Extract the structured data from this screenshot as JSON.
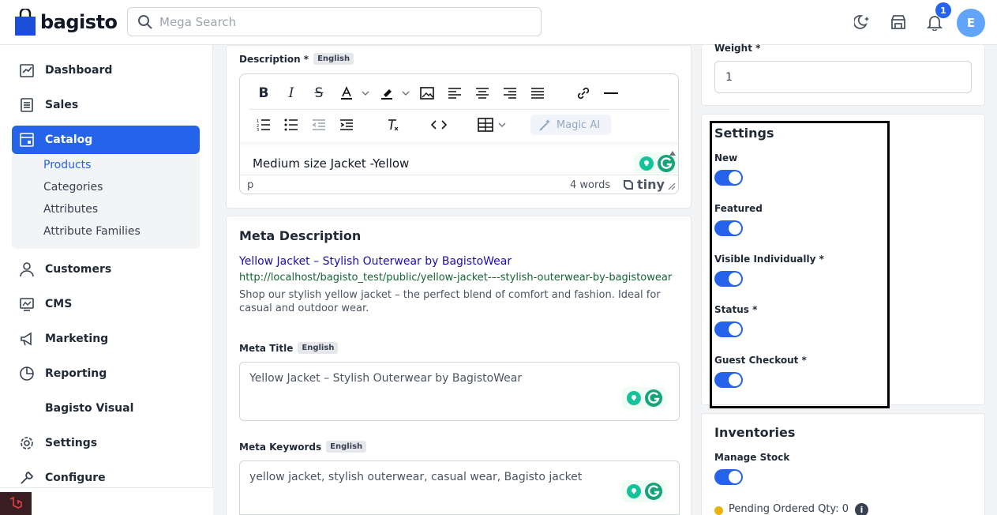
{
  "header": {
    "logo_text": "bagisto",
    "search_placeholder": "Mega Search",
    "notification_count": "1",
    "avatar_initial": "E"
  },
  "sidebar": {
    "items": [
      {
        "label": "Dashboard",
        "icon": "dashboard-icon"
      },
      {
        "label": "Sales",
        "icon": "sales-icon"
      },
      {
        "label": "Catalog",
        "icon": "catalog-icon"
      },
      {
        "label": "Customers",
        "icon": "customers-icon"
      },
      {
        "label": "CMS",
        "icon": "cms-icon"
      },
      {
        "label": "Marketing",
        "icon": "marketing-icon"
      },
      {
        "label": "Reporting",
        "icon": "reporting-icon"
      },
      {
        "label": "Bagisto Visual",
        "icon": ""
      },
      {
        "label": "Settings",
        "icon": "settings-icon"
      },
      {
        "label": "Configure",
        "icon": "configure-icon"
      }
    ],
    "catalog_sub": [
      "Products",
      "Categories",
      "Attributes",
      "Attribute Families"
    ]
  },
  "description": {
    "label": "Description *",
    "lang": "English",
    "magic_ai": "Magic AI",
    "content": "Medium size Jacket -Yellow",
    "path": "p",
    "word_count": "4 words",
    "brand": "tiny"
  },
  "meta": {
    "title": "Meta Description",
    "preview_title": "Yellow Jacket – Stylish Outerwear by BagistoWear",
    "preview_url": "http://localhost/bagisto_test/public/yellow-jacket-–-stylish-outerwear-by-bagistowear",
    "preview_desc": "Shop our stylish yellow jacket – the perfect blend of comfort and fashion. Ideal for casual and outdoor wear.",
    "meta_title_label": "Meta Title",
    "meta_title_value": "Yellow Jacket – Stylish Outerwear by BagistoWear",
    "meta_keywords_label": "Meta Keywords",
    "meta_keywords_value": "yellow jacket, stylish outerwear, casual wear, Bagisto jacket",
    "lang": "English"
  },
  "weight": {
    "label": "Weight *",
    "value": "1"
  },
  "settings": {
    "title": "Settings",
    "toggles": [
      "New",
      "Featured",
      "Visible Individually *",
      "Status *",
      "Guest Checkout *"
    ]
  },
  "inventories": {
    "title": "Inventories",
    "manage_stock": "Manage Stock",
    "pending": "Pending Ordered Qty: 0"
  },
  "colors": {
    "accent": "#2563eb"
  }
}
